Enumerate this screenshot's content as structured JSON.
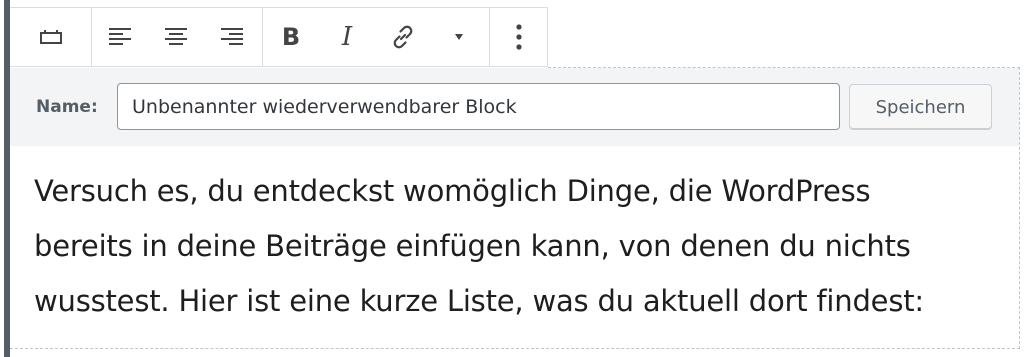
{
  "toolbar": {
    "block_type_icon": "block-icon",
    "align_left_icon": "align-left-icon",
    "align_center_icon": "align-center-icon",
    "align_right_icon": "align-right-icon",
    "bold_label": "B",
    "italic_label": "I",
    "link_icon": "link-icon",
    "more_formatting_icon": "caret-down-icon",
    "options_icon": "more-vertical-icon"
  },
  "reusable_block": {
    "name_label": "Name:",
    "name_value": "Unbenannter wiederverwendbarer Block",
    "save_label": "Speichern"
  },
  "content": {
    "lines": [
      "Versuch es, du entdeckst womöglich Dinge, die WordPress",
      "bereits in deine Beiträge einfügen kann, von denen du nichts",
      "wusstest. Hier ist eine kurze Liste, was du aktuell dort findest:"
    ]
  }
}
